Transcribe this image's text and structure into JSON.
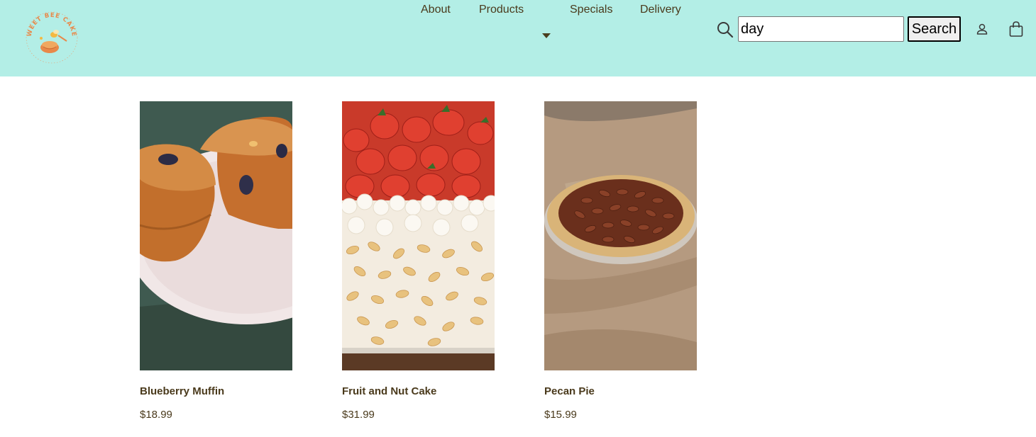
{
  "brand": {
    "logo_text": "SWEET BEE CAKES",
    "logo_icon": "bee-cake-logo"
  },
  "nav": {
    "items": [
      {
        "label": "About"
      },
      {
        "label": "Products",
        "has_dropdown": true
      },
      {
        "label": "Specials"
      },
      {
        "label": "Delivery"
      }
    ]
  },
  "search": {
    "icon": "search-icon",
    "value": "day",
    "button_label": "Search"
  },
  "header_icons": {
    "account": "account-icon",
    "cart": "shopping-bag-icon"
  },
  "colors": {
    "header_bg": "#b3eee6",
    "text": "#4a3a1c",
    "logo_orange": "#e8894a"
  },
  "products": [
    {
      "name": "Blueberry Muffin",
      "price": "$18.99",
      "image": "blueberry muffins on white plate"
    },
    {
      "name": "Fruit and Nut Cake",
      "price": "$31.99",
      "image": "strawberry cream cake with sliced almonds"
    },
    {
      "name": "Pecan Pie",
      "price": "$15.99",
      "image": "pecan pie on marble counter"
    }
  ]
}
